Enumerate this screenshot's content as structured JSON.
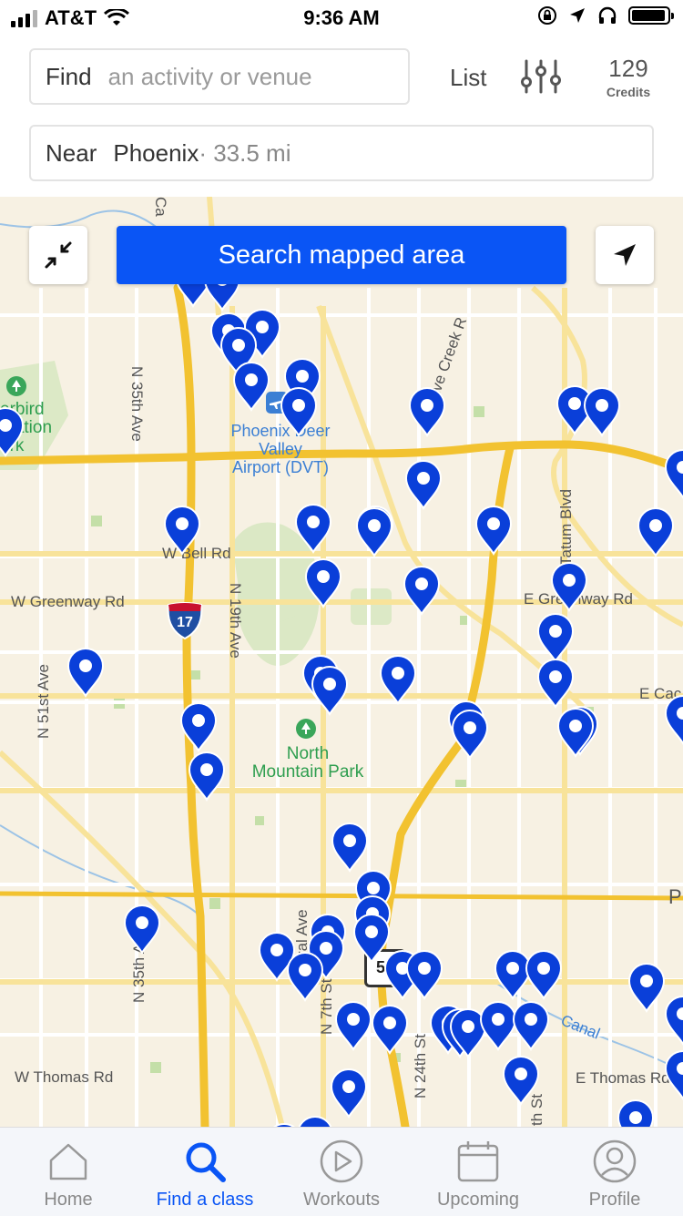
{
  "status_bar": {
    "carrier": "AT&T",
    "time": "9:36 AM",
    "battery_level": 0.95
  },
  "search": {
    "find_label": "Find",
    "find_placeholder": "an activity or venue",
    "near_label": "Near",
    "near_city": "Phoenix",
    "near_distance": " · 33.5 mi"
  },
  "header": {
    "list_label": "List",
    "credits_value": "129",
    "credits_label": "Credits"
  },
  "map": {
    "search_button": "Search mapped area",
    "labels": {
      "cave_creek": "Cave Creek R",
      "ca": "Ca",
      "deer_valley_1": "Phoenix Deer",
      "deer_valley_2": "Valley",
      "deer_valley_3": "Airport (DVT)",
      "park_1": "erbird",
      "park_2": "rvation",
      "park_3": "ark",
      "n35th": "N 35th Ave",
      "bell": "W Bell Rd",
      "greenway_w": "W Greenway Rd",
      "greenway_e": "E Greenway Rd",
      "n19th": "N 19th Ave",
      "n51st": "N 51st Ave",
      "tatum": "Tatum Blvd",
      "north_mtn_1": "North",
      "north_mtn_2": "Mountain Park",
      "cac": "E Cac",
      "central": "Central Ave",
      "s35th": "N 35th Ave",
      "n7th": "N 7th St",
      "n24th": "N 24th St",
      "thomas_w": "W Thomas Rd",
      "thomas_e": "E Thomas Rd",
      "canal": "Canal",
      "n_st": "th St",
      "p": "P",
      "i17": "17",
      "r51": "51"
    }
  },
  "tabs": [
    {
      "label": "Home",
      "icon": "home-icon"
    },
    {
      "label": "Find a class",
      "icon": "search-icon"
    },
    {
      "label": "Workouts",
      "icon": "play-icon"
    },
    {
      "label": "Upcoming",
      "icon": "calendar-icon"
    },
    {
      "label": "Profile",
      "icon": "profile-icon"
    }
  ],
  "colors": {
    "accent": "#0a55f5",
    "pin": "#0a3fd9",
    "map_bg": "#f7f1e3",
    "highway": "#f5c842"
  }
}
